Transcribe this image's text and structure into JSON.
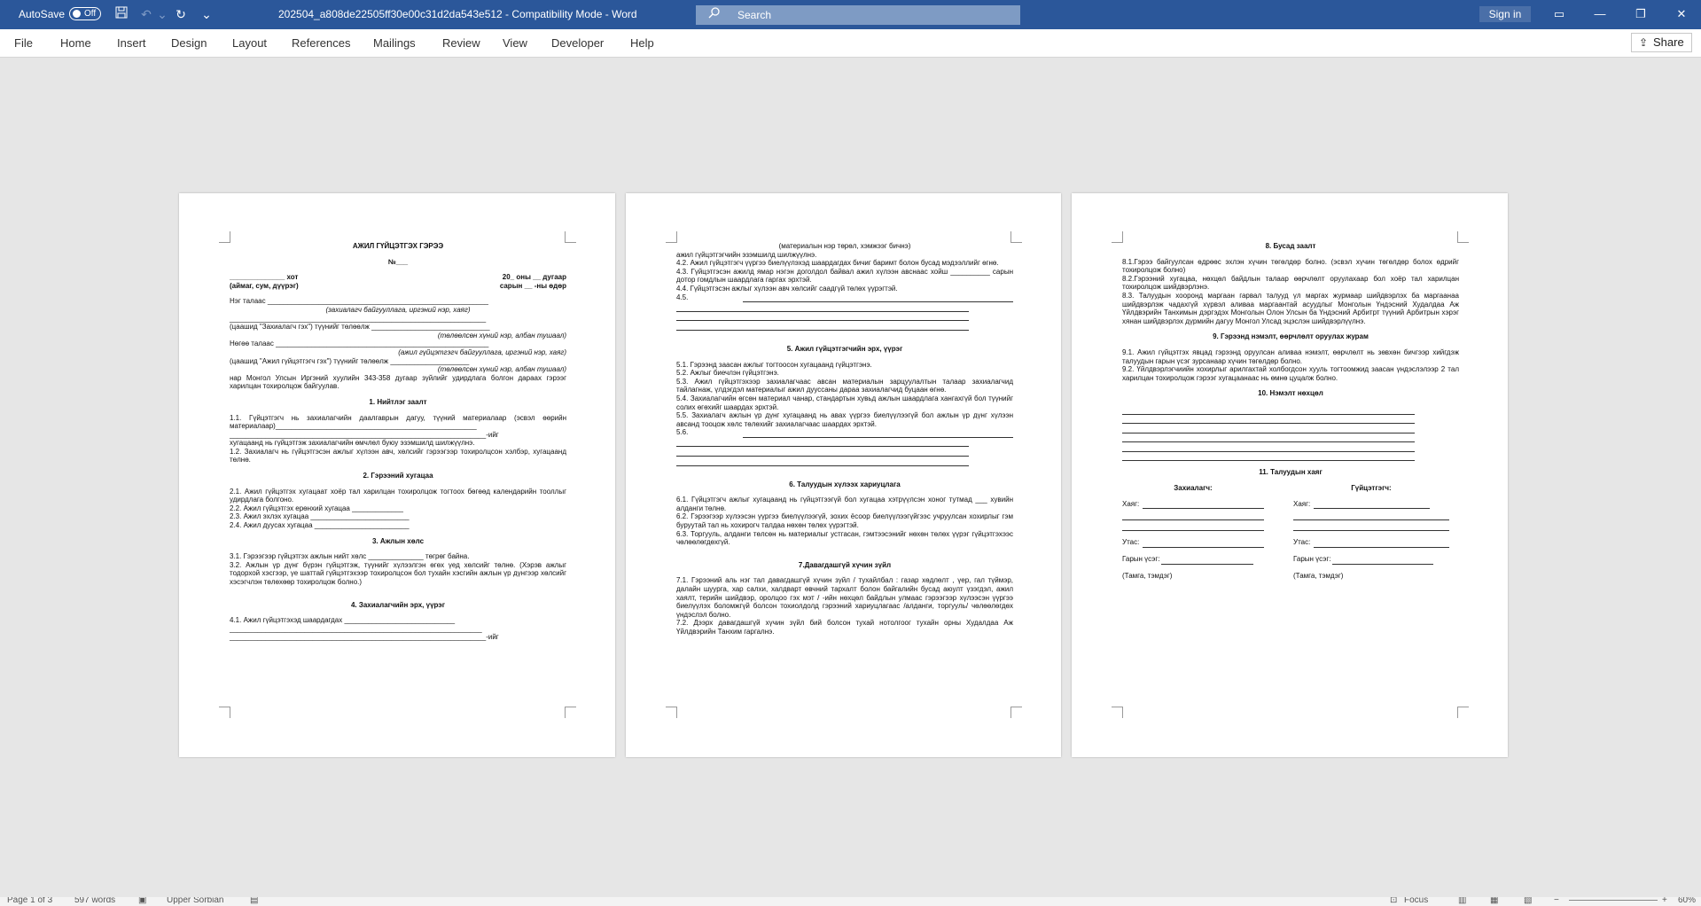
{
  "titlebar": {
    "autosave_label": "AutoSave",
    "autosave_state": "Off",
    "document_title": "202504_a808de22505ff30e00c31d2da543e512  -  Compatibility Mode  -  Word",
    "search_placeholder": "Search",
    "sign_in_label": "Sign in"
  },
  "ribbon": {
    "tabs": [
      "File",
      "Home",
      "Insert",
      "Design",
      "Layout",
      "References",
      "Mailings",
      "Review",
      "View",
      "Developer",
      "Help"
    ],
    "share_label": "Share"
  },
  "page1": {
    "title": "АЖИЛ ГҮЙЦЭТГЭХ ГЭРЭЭ",
    "number": "№___",
    "city": "______________ хот",
    "city_sub": "(аймаг, сум, дүүрэг)",
    "date": "20_ оны __ дугаар",
    "date_sub": "сарын __ -ны өдөр",
    "party1": "Нэг талаас  ________________________________________________________",
    "party1_sub": "(захиалагч байгууллага, иргэний нэр, хаяг)",
    "party1_line2": "_________________________________________________________________",
    "party1_line3": "(цаашид \"Захиалагч гэх\") түүнийг төлөөлж ______________________________",
    "party1_sub2": "(төлөөлсөн хүний нэр, албан тушаал)",
    "party2": "Нөгөө талаас ______________________________________________________",
    "party2_sub": "(ажил гүйцэтгэгч байгууллага, иргэний нэр, хаяг)",
    "party2_line2": "(цаашид \"Ажил гүйцэтгэгч гэх\") түүнийг төлөөлж ____________________",
    "party2_sub2": "(төлөөлсөн хүний нэр, албан тушаал)",
    "intro": "нар Монгол Улсын Иргэний хуулийн 343-358 дугаар зүйлийг удирдлага болгон дараах гэрээг харилцан тохиролцож байгуулав.",
    "s1": "1. Нийтлэг заалт",
    "s1_1": "1.1. Гүйцэтгэгч нь захиалагчийн даалгаврын дагуу, түүний материалаар (эсвэл өөрийн материалаар)___________________________________________________",
    "s1_1b": "_________________________________________________________________-ийг",
    "s1_1c": "хугацаанд нь гүйцэтгэж захиалагчийн өмчлөл буюу эзэмшилд шилжүүлнэ.",
    "s1_2": "1.2. Захиалагч нь гүйцэтгэсэн ажлыг хүлээн авч, хөлсийг гэрээгээр тохиролцсон хэлбэр, хугацаанд төлнө.",
    "s2": "2. Гэрээний хугацаа",
    "s2_1": "2.1. Ажил гүйцэтгэх хугацаат хоёр тал харилцан тохиролцож тогтоох бөгөөд календарийн тооллыг удирдлага болгоно.",
    "s2_2": "2.2. Ажил гүйцэтгэх ерөнхий хугацаа _____________",
    "s2_3": "2.3. Ажил эхлэх хугацаа _________________________",
    "s2_4": "2.4. Ажил дуусах хугацаа ________________________",
    "s3": "3. Ажлын хөлс",
    "s3_1": "3.1. Гэрээгээр гүйцэтгэх ажлын нийт хөлс ______________ төгрөг байна.",
    "s3_2": "3.2. Ажлын үр дүнг бүрэн гүйцэтгэж, түүнийг хүлээлгэн өгөх үед хөлсийг төлнө. (Хэрэв ажлыг тодорхой хэсгээр, үе шаттай гүйцэтгэхээр тохиролцсон бол тухайн хэсгийн ажлын үр дүнгээр хөлсийг хэсэгчлэн төлөхөөр тохиролцож болно.)",
    "s4": "4. Захиалагчийн эрх, үүрэг",
    "s4_1": "4.1.    Ажил    гүйцэтгэхэд    шаардагдах    ____________________________",
    "s4_1b": "________________________________________________________________",
    "s4_1c": "_________________________________________________________________-ийг"
  },
  "page2": {
    "top_sub": "(материалын нэр төрөл, хэмжээг бичнэ)",
    "l1": "ажил гүйцэтгэгчийн эзэмшилд шилжүүлнэ.",
    "s4_2": "4.2. Ажил гүйцэтгэгч үүргээ биелүүлэхэд шаардагдах бичиг баримт болон бусад мэдээллийг өгнө.",
    "s4_3": "4.3. Гүйцэтгэсэн ажилд ямар нэгэн доголдол байвал ажил хүлээн авснаас хойш __________ сарын дотор гомдлын шаардлага гаргах эрхтэй.",
    "s4_4": "4.4. Гүйцэтгэсэн ажлыг хүлээн авч хөлсийг саадгүй төлөх үүрэгтэй.",
    "s4_5": "4.5.",
    "s5": "5. Ажил гүйцэтгэгчийн эрх, үүрэг",
    "s5_1": "5.1. Гэрээнд заасан ажлыг тогтоосон хугацаанд гүйцэтгэнэ.",
    "s5_2": "5.2. Ажлыг биечлэн гүйцэтгэнэ.",
    "s5_3": "5.3. Ажил гүйцэтгэхээр захиалагчаас авсан материалын зарцуулалтын талаар захиалагчид тайлагнаж, үлдэгдэл материалыг ажил дууссаны дараа захиалагчид буцаан өгнө.",
    "s5_4": "5.4. Захиалагчийн өгсөн материал чанар, стандартын хувьд ажлын шаардлага хангахгүй бол түүнийг солих өгөхийг шаардах эрхтэй.",
    "s5_5": "5.5. Захиалагч ажлын үр дүнг хугацаанд нь авах үүргээ биелүүлээгүй бол ажлын үр дүнг хүлээн авсанд тооцож хөлс төлөхийг захиалагчаас шаардах эрхтэй.",
    "s5_6": "5.6.",
    "s6": "6. Талуудын хүлээх хариуцлага",
    "s6_1": "6.1. Гүйцэтгэгч ажлыг хугацаанд нь гүйцэтгээгүй бол хугацаа хэтрүүлсэн хоног тутмад ___ хувийн алданги төлнө.",
    "s6_2": "6.2. Гэрээгээр хүлээсэн үүргээ биелүүлээгүй, зохих ёсоор биелүүлээгүйгээс учруулсан хохирлыг гэм буруутай тал нь хохирогч талдаа нөхөн төлөх үүрэгтэй.",
    "s6_3": "6.3. Торгууль, алданги төлсөн нь материалыг устгасан, гэмтээсэнийг нөхөн төлөх үүрэг гүйцэтгэхээс чөлөөлөгдөхгүй.",
    "s7": "7.Давагдашгүй хүчин зүйл",
    "s7_1": "7.1. Гэрээний аль нэг тал давагдашгүй хүчин зүйл / тухайлбал : газар хөдлөлт , үер, гал түймэр, далайн шуурга, хар салхи, халдварт өвчний тархалт болон байгалийн бусад аюулт үзэгдэл, ажил хаялт, терийн шийдвэр, оролцоо гэх мэт / -ийн нөхцөл байдлын улмаас гэрээгээр хүлээсэн үүргээ биелүүлэх боломжгүй болсон тохиолдолд гэрээний хариуцлагаас /алданги, торгууль/ чөлөөлөгдөх үндэслэл болно.",
    "s7_2": "7.2. Дээрх давагдашгүй хүчин зүйл бий болсон тухай нотолгоог тухайн орны Худалдаа Аж Үйлдвэрийн Танхим гаргалнэ."
  },
  "page3": {
    "s8": "8. Бусад заалт",
    "s8_1": "8.1.Гэрээ байгуулсан өдрөөс эхлэн хүчин төгөлдөр болно. (эсвэл хүчин төгөлдөр болох өдрийг тохиролцож болно)",
    "s8_2": "8.2.Гэрээний хугацаа, нөхцөл байдлын талаар өөрчлөлт оруулахаар бол хоёр тал харилцан тохиролцож шийдвэрлэнэ.",
    "s8_3": "8.3. Талуудын хооронд маргаан гарвал талууд үл маргах журмаар шийдвэрлэх ба маргаанаа шийдвэрлэж чадахгүй хүрвэл аливаа маргаантай асуудлыг Монголын Үндэсний Худалдаа Аж Үйлдвэрийн Танхимын дэргэдэх Монголын Олон Улсын ба Үндэсний Арбитрт түүний Арбитрын хэрэг хянан шийдвэрлэх дүрмийн дагуу Монгол Улсад эцэслэн шийдвэрлүүлнэ.",
    "s9": "9. Гэрээнд нэмэлт, өөрчлөлт оруулах журам",
    "s9_1": "9.1. Ажил гүйцэтгэх явцад гэрээнд оруулсан аливаа нэмэлт, өөрчлөлт нь зөвхөн бичгээр хийгдэж талуудын гарын үсэг зурсанаар хүчин төгөлдөр болно.",
    "s9_2": "9.2. Үйлдвэрлэгчиийн хохирлыг арилгахтай холбогдсон хууль тогтоомжид заасан үндэслэлээр 2 тал харилцан тохиролцож гэрээг хугацаанаас нь өмнө цуцалж болно.",
    "s10": "10. Нэмэлт нөхцөл",
    "s11": "11. Талуудын хаяг",
    "customer": "Захиалагч:",
    "contractor": "Гүйцэтгэгч:",
    "address": "Хаяг:",
    "phone": "Утас:",
    "signature": "Гарын үсэг:",
    "stamp": "(Тамга, тэмдэг)"
  },
  "statusbar": {
    "page": "Page 1 of 3",
    "words": "597 words",
    "language": "Upper Sorbian",
    "focus": "Focus",
    "zoom": "60%"
  }
}
